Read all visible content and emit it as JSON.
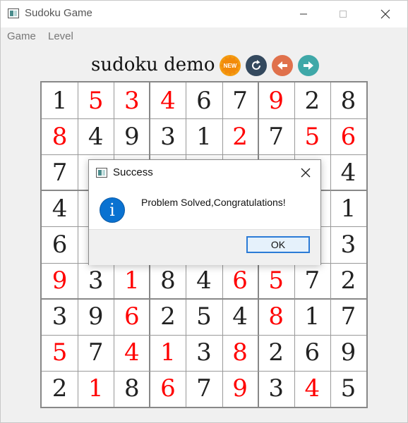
{
  "window": {
    "title": "Sudoku Game",
    "menu": [
      "Game",
      "Level"
    ]
  },
  "header": {
    "title": "sudoku demo",
    "new_badge": "NEW",
    "buttons": [
      "new-icon",
      "reset-icon",
      "back-icon",
      "forward-icon"
    ]
  },
  "colors": {
    "given_digit": "#222222",
    "user_digit": "#ff0000",
    "new_button": "#f39c12",
    "reset_button": "#34495e",
    "back_button": "#e0714c",
    "forward_button": "#3fa8a8",
    "info_icon": "#0a72d1"
  },
  "board": {
    "rows": [
      [
        {
          "v": "1",
          "u": false
        },
        {
          "v": "5",
          "u": true
        },
        {
          "v": "3",
          "u": true
        },
        {
          "v": "4",
          "u": true
        },
        {
          "v": "6",
          "u": false
        },
        {
          "v": "7",
          "u": false
        },
        {
          "v": "9",
          "u": true
        },
        {
          "v": "2",
          "u": false
        },
        {
          "v": "8",
          "u": false
        }
      ],
      [
        {
          "v": "8",
          "u": true
        },
        {
          "v": "4",
          "u": false
        },
        {
          "v": "9",
          "u": false
        },
        {
          "v": "3",
          "u": false
        },
        {
          "v": "1",
          "u": false
        },
        {
          "v": "2",
          "u": true
        },
        {
          "v": "7",
          "u": false
        },
        {
          "v": "5",
          "u": true
        },
        {
          "v": "6",
          "u": true
        }
      ],
      [
        {
          "v": "7",
          "u": false
        },
        null,
        null,
        null,
        null,
        null,
        null,
        null,
        {
          "v": "4",
          "u": false
        }
      ],
      [
        {
          "v": "4",
          "u": false
        },
        null,
        null,
        null,
        null,
        null,
        null,
        null,
        {
          "v": "1",
          "u": false
        }
      ],
      [
        {
          "v": "6",
          "u": false
        },
        null,
        null,
        null,
        null,
        null,
        null,
        null,
        {
          "v": "3",
          "u": false
        }
      ],
      [
        {
          "v": "9",
          "u": true
        },
        {
          "v": "3",
          "u": false
        },
        {
          "v": "1",
          "u": true
        },
        {
          "v": "8",
          "u": false
        },
        {
          "v": "4",
          "u": false
        },
        {
          "v": "6",
          "u": true
        },
        {
          "v": "5",
          "u": true
        },
        {
          "v": "7",
          "u": false
        },
        {
          "v": "2",
          "u": false
        }
      ],
      [
        {
          "v": "3",
          "u": false
        },
        {
          "v": "9",
          "u": false
        },
        {
          "v": "6",
          "u": true
        },
        {
          "v": "2",
          "u": false
        },
        {
          "v": "5",
          "u": false
        },
        {
          "v": "4",
          "u": false
        },
        {
          "v": "8",
          "u": true
        },
        {
          "v": "1",
          "u": false
        },
        {
          "v": "7",
          "u": false
        }
      ],
      [
        {
          "v": "5",
          "u": true
        },
        {
          "v": "7",
          "u": false
        },
        {
          "v": "4",
          "u": true
        },
        {
          "v": "1",
          "u": true
        },
        {
          "v": "3",
          "u": false
        },
        {
          "v": "8",
          "u": true
        },
        {
          "v": "2",
          "u": false
        },
        {
          "v": "6",
          "u": false
        },
        {
          "v": "9",
          "u": false
        }
      ],
      [
        {
          "v": "2",
          "u": false
        },
        {
          "v": "1",
          "u": true
        },
        {
          "v": "8",
          "u": false
        },
        {
          "v": "6",
          "u": true
        },
        {
          "v": "7",
          "u": false
        },
        {
          "v": "9",
          "u": true
        },
        {
          "v": "3",
          "u": false
        },
        {
          "v": "4",
          "u": true
        },
        {
          "v": "5",
          "u": false
        }
      ]
    ]
  },
  "dialog": {
    "title": "Success",
    "message": "Problem Solved,Congratulations!",
    "ok_label": "OK"
  }
}
